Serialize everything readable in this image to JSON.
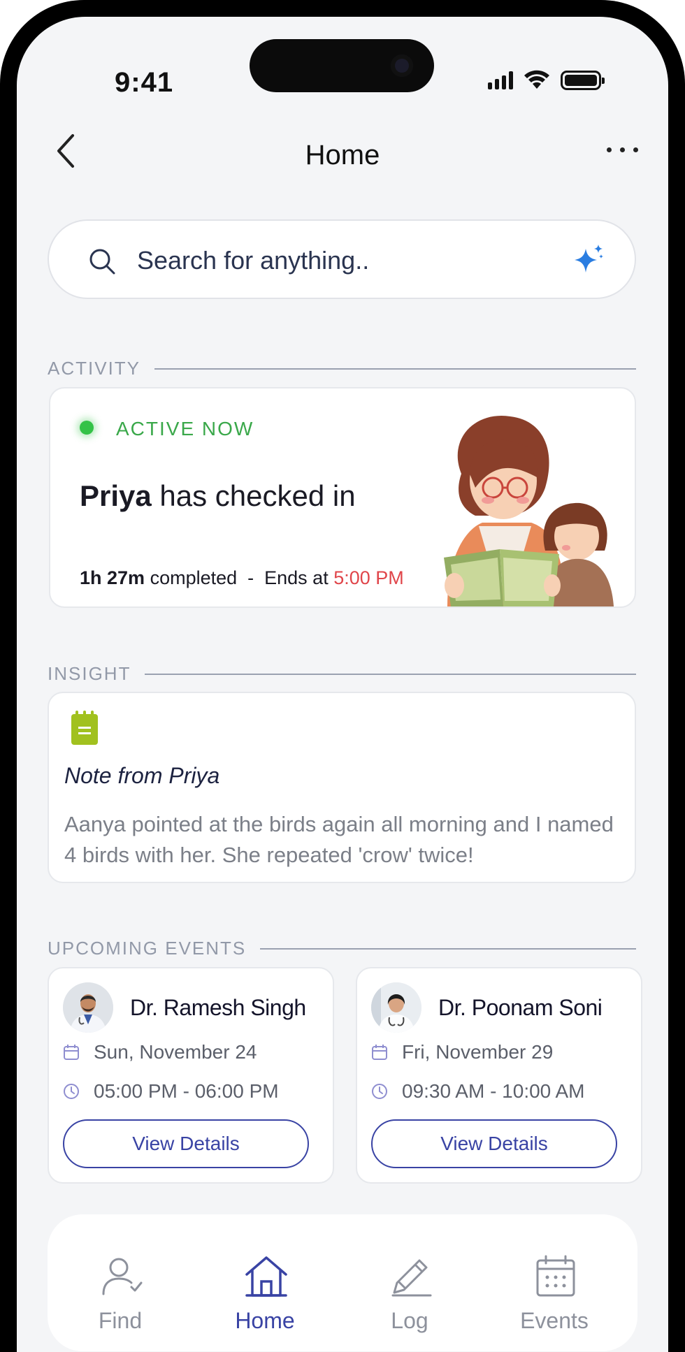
{
  "status_bar": {
    "time": "9:41"
  },
  "header": {
    "title": "Home"
  },
  "search": {
    "placeholder": "Search for anything.."
  },
  "sections": {
    "activity": "ACTIVITY",
    "insight": "INSIGHT",
    "events": "UPCOMING EVENTS"
  },
  "activity": {
    "status": "ACTIVE NOW",
    "name": "Priya",
    "message": " has checked in",
    "duration": "1h 27m",
    "completed_text": " completed  -  Ends at ",
    "end_time": "5:00 PM",
    "status_color": "#34c247",
    "end_time_color": "#e0454a"
  },
  "insight": {
    "title": "Note from Priya",
    "body": "Aanya pointed at the birds again all morning and I named 4 birds with her. She repeated 'crow' twice!",
    "icon": "notepad-icon"
  },
  "events": [
    {
      "doctor": "Dr. Ramesh Singh",
      "date": "Sun, November 24",
      "time": "05:00 PM - 06:00 PM",
      "button": "View Details"
    },
    {
      "doctor": "Dr. Poonam Soni",
      "date": "Fri, November 29",
      "time": "09:30 AM - 10:00 AM",
      "button": "View Details"
    }
  ],
  "tabs": [
    {
      "label": "Find",
      "icon": "person-check-icon",
      "active": false
    },
    {
      "label": "Home",
      "icon": "home-icon",
      "active": true
    },
    {
      "label": "Log",
      "icon": "pencil-icon",
      "active": false
    },
    {
      "label": "Events",
      "icon": "calendar-icon",
      "active": false
    }
  ],
  "colors": {
    "accent": "#3943a4",
    "background": "#f4f5f7"
  }
}
